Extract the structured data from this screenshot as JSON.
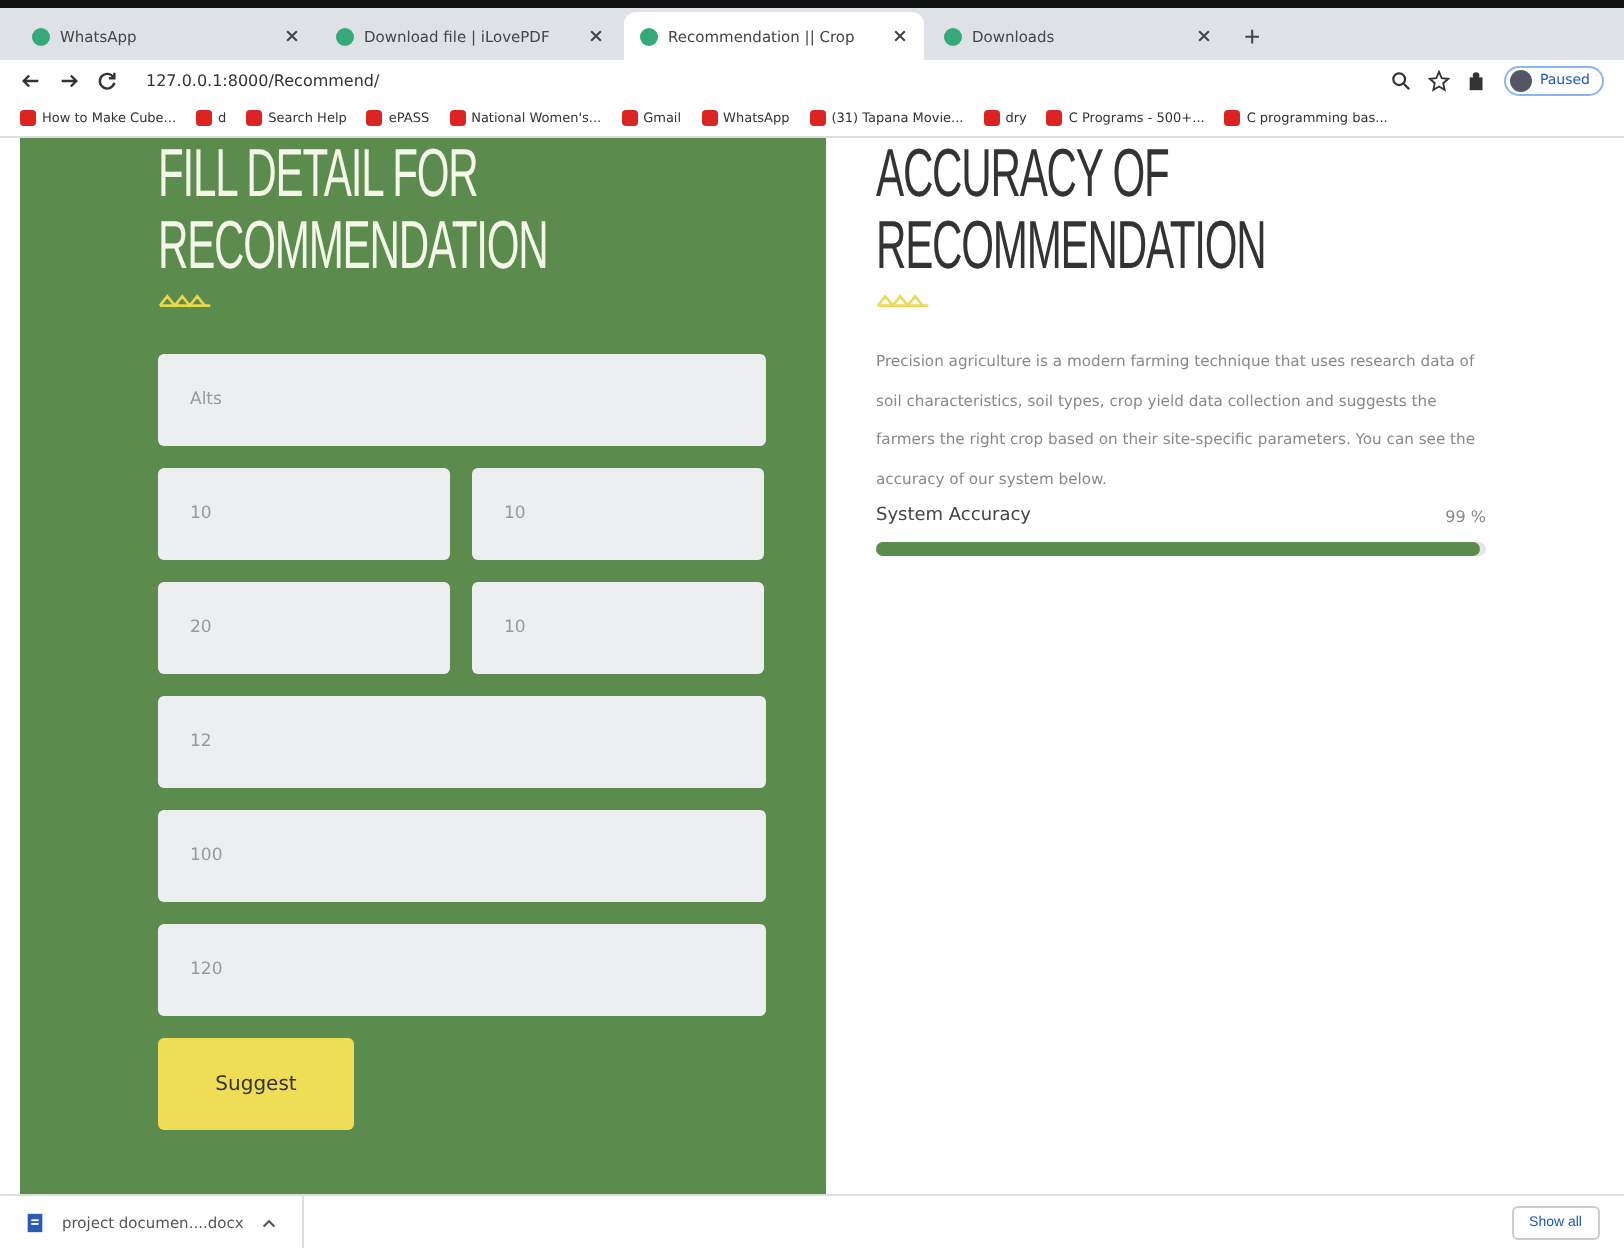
{
  "tabs": [
    {
      "label": "WhatsApp",
      "selected": false
    },
    {
      "label": "Download file | iLovePDF",
      "selected": false
    },
    {
      "label": "Recommendation || Crop",
      "selected": true
    },
    {
      "label": "Downloads",
      "selected": false
    }
  ],
  "new_tab": "+",
  "address_bar": {
    "url": "127.0.0.1:8000/Recommend/"
  },
  "profile": {
    "label": "Paused"
  },
  "bookmarks": [
    "How to Make Cube...",
    "d",
    "Search Help",
    "ePASS",
    "National Women's...",
    "Gmail",
    "WhatsApp",
    "(31) Tapana Movie...",
    "dry",
    "C Programs - 500+...",
    "C programming bas..."
  ],
  "form": {
    "heading_lines": [
      "FILL DETAIL FOR",
      "RECOMMENDATION"
    ],
    "fields": [
      {
        "placeholder": "Alts",
        "kind": "full"
      },
      {
        "placeholder": "10",
        "kind": "half"
      },
      {
        "placeholder": "10",
        "kind": "half"
      },
      {
        "placeholder": "20",
        "kind": "half"
      },
      {
        "placeholder": "10",
        "kind": "half"
      },
      {
        "placeholder": "12",
        "kind": "full"
      },
      {
        "placeholder": "100",
        "kind": "full"
      },
      {
        "placeholder": "120",
        "kind": "full"
      }
    ],
    "submit": "Suggest"
  },
  "accuracy": {
    "heading_lines": [
      "ACCURACY OF",
      "RECOMMENDATION"
    ],
    "description": "Precision agriculture is a modern farming technique that uses research data of soil characteristics, soil types, crop yield data collection and suggests the farmers the right crop based on their site-specific parameters. You can see the accuracy of our system below.",
    "label": "System Accuracy",
    "reading": "99 %",
    "level": 0.99
  },
  "download_bar": {
    "file": "project documen....docx",
    "show_all": "Show all"
  }
}
